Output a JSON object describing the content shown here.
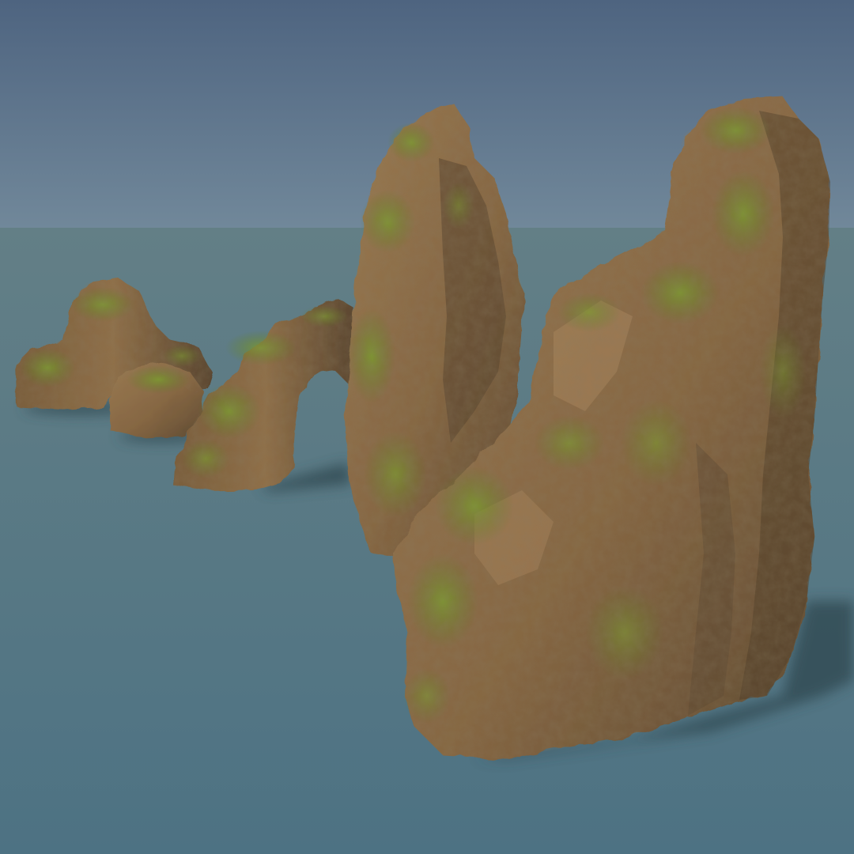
{
  "scene": {
    "colors": {
      "sky_top": "#4e6480",
      "sky_horizon": "#6f8a96",
      "ground_far": "#5c7a80",
      "ground_near": "#4f7484",
      "rock_base": "#8a6a44",
      "rock_shadow": "#4a3a26",
      "rock_highlight": "#b08a5e",
      "moss": "#6b8a2a",
      "moss_dark": "#4a6420",
      "cast_shadow": "#2f4650"
    },
    "objects": [
      "small-boulder-cluster",
      "rock-arch",
      "tall-rock-spire",
      "large-rock-formation"
    ]
  }
}
